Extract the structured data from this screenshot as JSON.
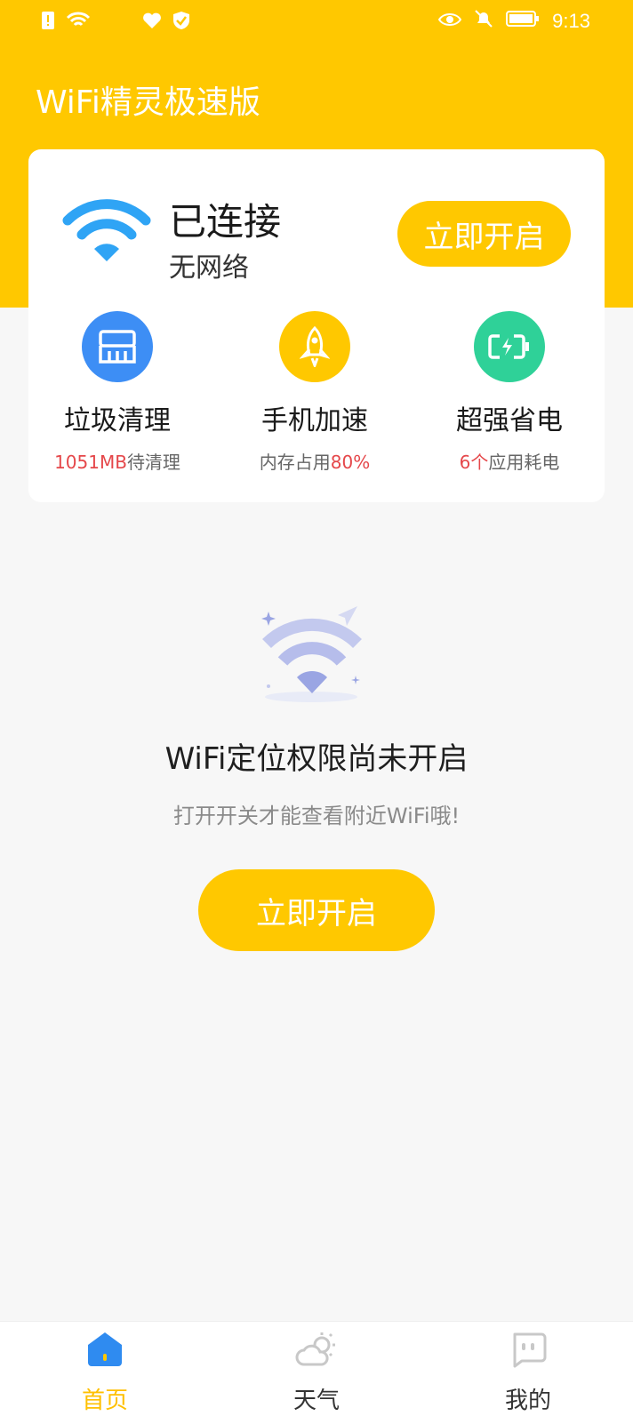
{
  "status_bar": {
    "time": "9:13"
  },
  "app": {
    "title": "WiFi精灵极速版"
  },
  "connection": {
    "status": "已连接",
    "network": "无网络",
    "open_button": "立即开启"
  },
  "features": [
    {
      "title": "垃圾清理",
      "highlight": "1051MB",
      "suffix": "待清理",
      "icon": "brush-icon",
      "color": "#3d8ef5"
    },
    {
      "prefix": "内存占用",
      "title": "手机加速",
      "highlight": "80%",
      "icon": "rocket-icon",
      "color": "#ffc800"
    },
    {
      "title": "超强省电",
      "highlight": "6个",
      "suffix": "应用耗电",
      "icon": "battery-icon",
      "color": "#2fd198"
    }
  ],
  "empty_state": {
    "title": "WiFi定位权限尚未开启",
    "subtitle": "打开开关才能查看附近WiFi哦!",
    "button": "立即开启"
  },
  "nav": [
    {
      "label": "首页",
      "icon": "home-icon",
      "active": true
    },
    {
      "label": "天气",
      "icon": "weather-icon",
      "active": false
    },
    {
      "label": "我的",
      "icon": "profile-icon",
      "active": false
    }
  ],
  "colors": {
    "brand": "#ffc800",
    "accent_red": "#e5474a"
  }
}
